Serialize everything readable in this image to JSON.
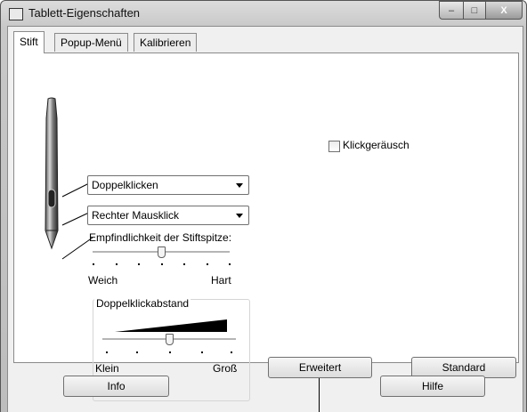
{
  "window": {
    "title": "Tablett-Eigenschaften",
    "controls": {
      "minimize": "–",
      "maximize": "□",
      "close": "X"
    }
  },
  "tabs": [
    {
      "label": "Stift"
    },
    {
      "label": "Popup-Menü"
    },
    {
      "label": "Kalibrieren"
    }
  ],
  "pen": {
    "upper_button": {
      "value": "Doppelklicken"
    },
    "lower_button": {
      "value": "Rechter Mausklick"
    },
    "tip_sensitivity": {
      "label": "Empfindlichkeit der Stiftspitze:",
      "min_label": "Weich",
      "max_label": "Hart",
      "level": 0.5
    }
  },
  "double_click": {
    "label": "Doppelklickabstand",
    "min_label": "Klein",
    "max_label": "Groß",
    "level": 0.5
  },
  "click_sound": {
    "label": "Klickgeräusch",
    "checked": false
  },
  "buttons": {
    "advanced": "Erweitert",
    "default": "Standard",
    "info": "Info",
    "help": "Hilfe"
  }
}
